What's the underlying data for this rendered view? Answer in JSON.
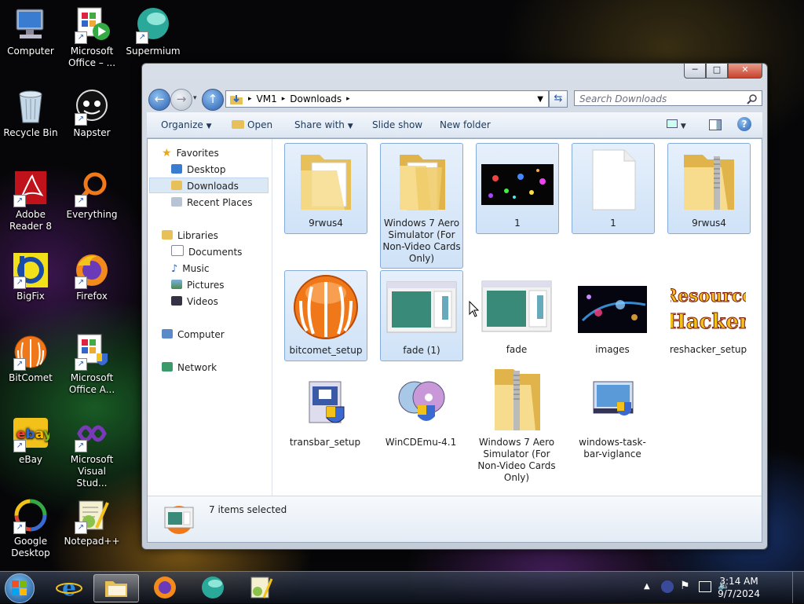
{
  "desktop": {
    "icons": [
      {
        "label": "Computer"
      },
      {
        "label": "Microsoft Office – ..."
      },
      {
        "label": "Supermium"
      },
      {
        "label": "Recycle Bin"
      },
      {
        "label": "Napster"
      },
      {
        "label": "Adobe Reader 8"
      },
      {
        "label": "Everything"
      },
      {
        "label": "BigFix"
      },
      {
        "label": "Firefox"
      },
      {
        "label": "BitComet"
      },
      {
        "label": "Microsoft Office A..."
      },
      {
        "label": "eBay"
      },
      {
        "label": "Microsoft Visual Stud..."
      },
      {
        "label": "Google Desktop"
      },
      {
        "label": "Notepad++"
      }
    ]
  },
  "window": {
    "caption": {
      "minimize": "─",
      "maximize": "□",
      "close": "✕"
    },
    "address": {
      "crumbs": [
        "VM1",
        "Downloads"
      ],
      "separator": "▸"
    },
    "search_placeholder": "Search Downloads",
    "toolbar": {
      "organize": "Organize",
      "open": "Open",
      "share_with": "Share with",
      "slide_show": "Slide show",
      "new_folder": "New folder"
    },
    "nav": {
      "favorites": "Favorites",
      "desktop": "Desktop",
      "downloads": "Downloads",
      "recent_places": "Recent Places",
      "libraries": "Libraries",
      "documents": "Documents",
      "music": "Music",
      "pictures": "Pictures",
      "videos": "Videos",
      "computer": "Computer",
      "network": "Network"
    },
    "files": [
      {
        "name": "9rwus4",
        "selected": true
      },
      {
        "name": "Windows 7 Aero Simulator (For Non-Video Cards Only)",
        "selected": true
      },
      {
        "name": "1",
        "selected": true
      },
      {
        "name": "1",
        "selected": true
      },
      {
        "name": "9rwus4",
        "selected": true
      },
      {
        "name": "bitcomet_setup",
        "selected": true
      },
      {
        "name": "fade (1)",
        "selected": true
      },
      {
        "name": "fade",
        "selected": false
      },
      {
        "name": "images",
        "selected": false
      },
      {
        "name": "reshacker_setup",
        "selected": false
      },
      {
        "name": "transbar_setup",
        "selected": false
      },
      {
        "name": "WinCDEmu-4.1",
        "selected": false
      },
      {
        "name": "Windows 7 Aero Simulator (For Non-Video Cards Only)",
        "selected": false
      },
      {
        "name": "windows-task-bar-viglance",
        "selected": false
      }
    ],
    "reshacker_logo_text": "Resource Hacker",
    "status": "7 items selected"
  },
  "taskbar": {
    "time": "3:14 AM",
    "date": "9/7/2024"
  },
  "colors": {
    "accent": "#3a78c8",
    "folder": "#f2d27a",
    "selection": "#cfe2f7"
  }
}
